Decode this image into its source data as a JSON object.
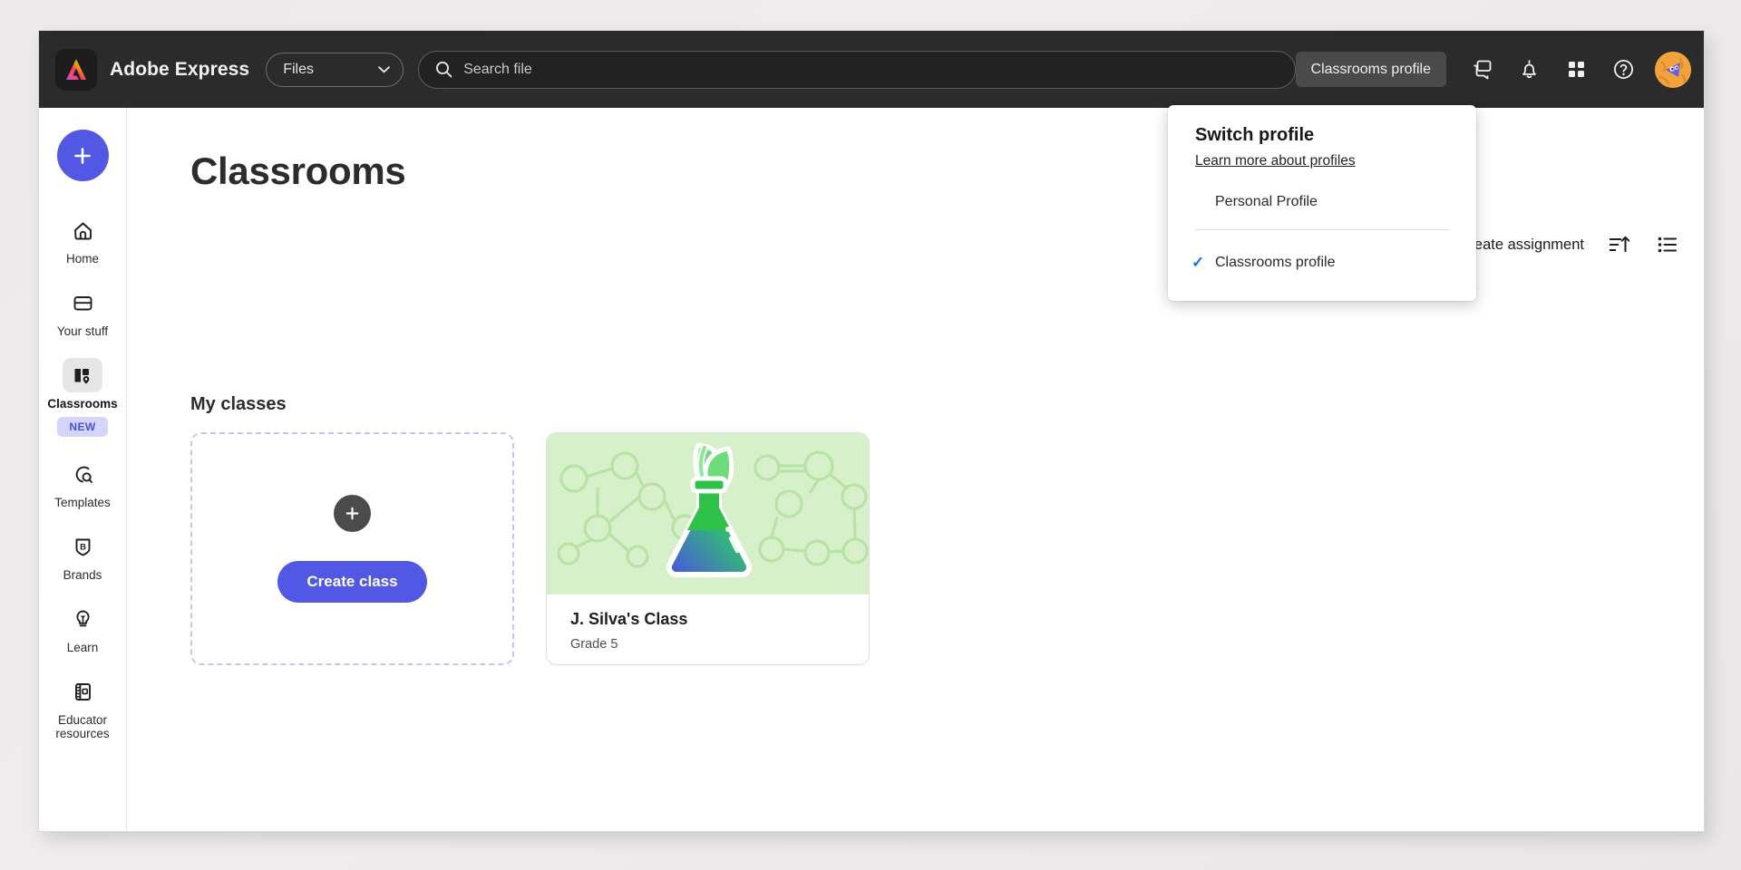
{
  "header": {
    "logo_icon": "adobe-express-logo",
    "brand": "Adobe Express",
    "files_select": {
      "value": "Files",
      "chevron_icon": "chevron-down-icon"
    },
    "search": {
      "placeholder": "Search file",
      "icon": "search-icon"
    },
    "profile_pill": "Classrooms profile",
    "icons": [
      {
        "name": "chat-icon",
        "label": "Messages"
      },
      {
        "name": "bell-icon",
        "label": "Notifications"
      },
      {
        "name": "apps-grid-icon",
        "label": "Apps"
      },
      {
        "name": "help-circle-icon",
        "label": "Help"
      }
    ],
    "avatar_name": "user-avatar"
  },
  "sidebar": {
    "create_button": {
      "icon": "plus-icon",
      "label": "Create new"
    },
    "items": [
      {
        "label": "Home",
        "icon": "home-icon",
        "active": false,
        "badge": ""
      },
      {
        "label": "Your stuff",
        "icon": "folder-icon",
        "active": false,
        "badge": ""
      },
      {
        "label": "Classrooms",
        "icon": "classrooms-icon",
        "active": true,
        "badge": "NEW"
      },
      {
        "label": "Templates",
        "icon": "templates-search-icon",
        "active": false,
        "badge": ""
      },
      {
        "label": "Brands",
        "icon": "brand-shield-icon",
        "active": false,
        "badge": ""
      },
      {
        "label": "Learn",
        "icon": "lightbulb-icon",
        "active": false,
        "badge": ""
      },
      {
        "label": "Educator resources",
        "icon": "notebook-icon",
        "active": false,
        "badge": ""
      }
    ]
  },
  "main": {
    "page_title": "Classrooms",
    "toolbar": {
      "create_assignment": "Create assignment",
      "sort_icon": "sort-ascending-icon",
      "view_icon": "list-view-icon"
    },
    "section_title": "My classes",
    "create_card": {
      "plus_icon": "plus-icon",
      "button_label": "Create class"
    },
    "classes": [
      {
        "name": "J. Silva's Class",
        "grade": "Grade 5",
        "thumbnail": "science-flask-sprout",
        "thumb_bg": "#d6f0ca"
      }
    ]
  },
  "profile_menu": {
    "title": "Switch profile",
    "link": "Learn more about profiles",
    "items": [
      {
        "label": "Personal Profile",
        "checked": false
      },
      {
        "label": "Classrooms profile",
        "checked": true
      }
    ],
    "check_icon": "check-icon",
    "check_color": "#1473e6"
  },
  "colors": {
    "accent_purple": "#5258e4",
    "header_dark": "#2b2b2b",
    "badge_bg": "#d5d4fb",
    "badge_text": "#4a50d8",
    "page_bg": "#eeeeee"
  }
}
